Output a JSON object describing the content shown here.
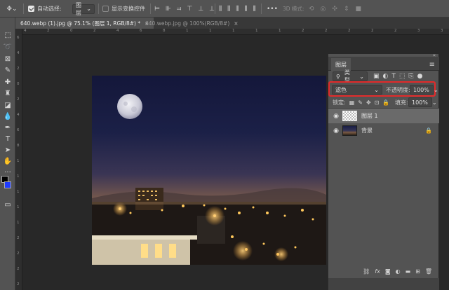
{
  "options_bar": {
    "auto_select_label": "自动选择:",
    "auto_select_target": "图层",
    "show_transform_label": "显示变换控件",
    "mode_3d_label": "3D 模式:",
    "more": "•••"
  },
  "tabs": [
    {
      "label": "640.webp (1).jpg @ 75.1% (图层 1, RGB/8#) *",
      "close": "×"
    },
    {
      "label": "640.webp.jpg @ 100%(RGB/8#)",
      "close": "×"
    }
  ],
  "ruler_top_ticks": [
    "4",
    "2",
    "0",
    "2",
    "4",
    "6",
    "8",
    "1",
    "1",
    "1",
    "1",
    "1",
    "2",
    "2",
    "2",
    "2",
    "2",
    "3",
    "3"
  ],
  "ruler_left_ticks": [
    "6",
    "4",
    "2",
    "0",
    "2",
    "4",
    "6",
    "8",
    "1",
    "1",
    "1",
    "1",
    "1",
    "2",
    "2",
    "2",
    "2"
  ],
  "layers_panel": {
    "tab_label": "图层",
    "filter_kind": "类型",
    "blend_mode": "滤色",
    "opacity_label": "不透明度:",
    "opacity_value": "100%",
    "lock_label": "锁定:",
    "fill_label": "填充:",
    "fill_value": "100%",
    "layers": [
      {
        "name": "图层 1",
        "selected": true,
        "thumb": "transparent"
      },
      {
        "name": "背景",
        "selected": false,
        "thumb": "photo",
        "locked": true
      }
    ],
    "footer_fx": "fx"
  },
  "colors": {
    "foreground": "#000000",
    "background": "#1e3bff",
    "highlight_border": "#e22a2a"
  }
}
